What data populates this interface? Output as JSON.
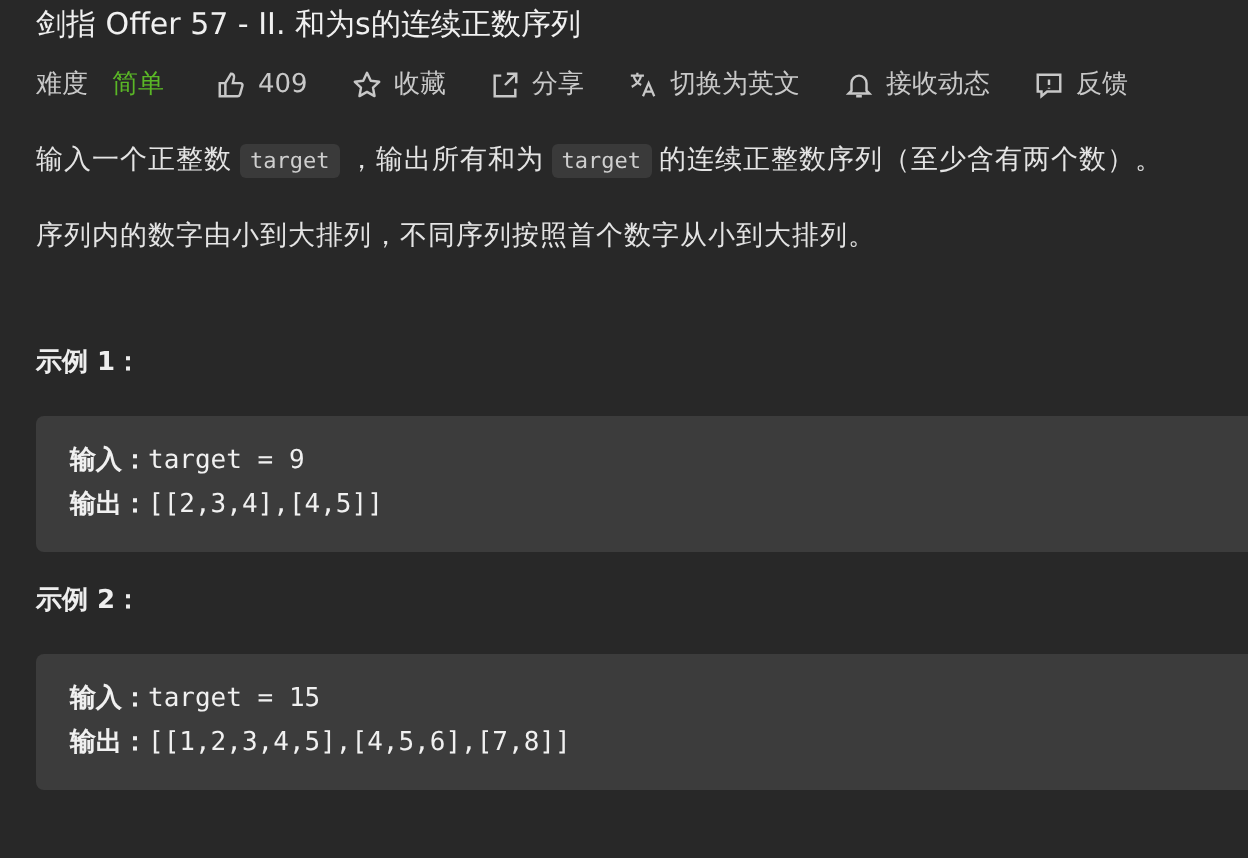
{
  "title": "剑指 Offer 57 - II. 和为s的连续正数序列",
  "difficulty": {
    "label": "难度",
    "value": "简单"
  },
  "actions": [
    {
      "kind": "like",
      "label": "409"
    },
    {
      "kind": "star",
      "label": "收藏"
    },
    {
      "kind": "share",
      "label": "分享"
    },
    {
      "kind": "translate",
      "label": "切换为英文"
    },
    {
      "kind": "bell",
      "label": "接收动态"
    },
    {
      "kind": "feedback",
      "label": "反馈"
    }
  ],
  "description": [
    [
      {
        "kind": "text",
        "text": "输入一个正整数"
      },
      {
        "kind": "code",
        "text": "target"
      },
      {
        "kind": "text",
        "text": "，输出所有和为"
      },
      {
        "kind": "code",
        "text": "target"
      },
      {
        "kind": "text",
        "text": "的连续正整数序列（至少含有两个数）。"
      }
    ],
    [
      {
        "kind": "text",
        "text": "序列内的数字由小到大排列，不同序列按照首个数字从小到大排列。"
      }
    ]
  ],
  "examples": [
    {
      "title": "示例 1：",
      "lines": [
        "**输入：**target = 9",
        "**输出：**[[2,3,4],[4,5]]"
      ]
    },
    {
      "title": "示例 2：",
      "lines": [
        "**输入：**target = 15",
        "**输出：**[[1,2,3,4,5],[4,5,6],[7,8]]"
      ]
    }
  ]
}
